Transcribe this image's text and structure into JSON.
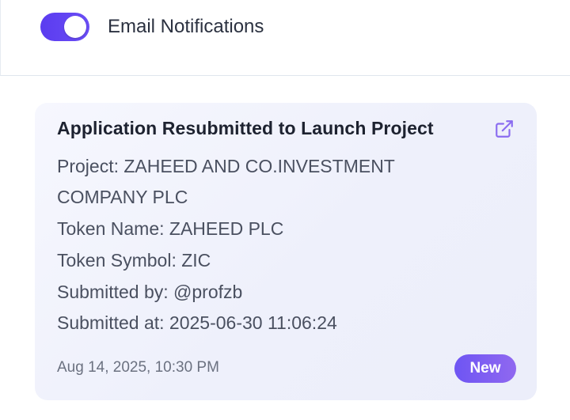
{
  "settings": {
    "email_notifications_label": "Email Notifications",
    "email_notifications_enabled": true
  },
  "notification": {
    "title": "Application Resubmitted to Launch Project",
    "project_line1": "Project: ZAHEED AND CO.INVESTMENT",
    "project_line2": "COMPANY PLC",
    "token_name": "Token Name: ZAHEED PLC",
    "token_symbol": "Token Symbol: ZIC",
    "submitted_by": "Submitted by: @profzb",
    "submitted_at": "Submitted at: 2025-06-30 11:06:24",
    "timestamp": "Aug 14, 2025, 10:30 PM",
    "badge": "New",
    "icon": "external-link-icon"
  },
  "colors": {
    "accent": "#5b3cf0",
    "badge_start": "#6e55f3",
    "badge_end": "#9068f0",
    "icon": "#8a6cf0"
  }
}
